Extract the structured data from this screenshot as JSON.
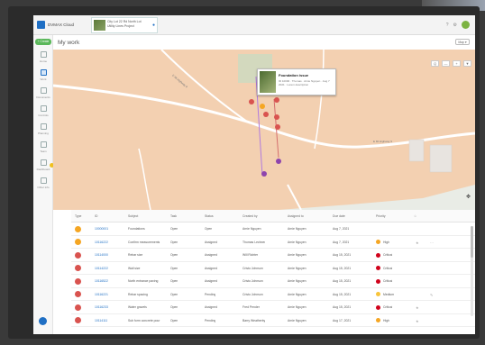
{
  "app": {
    "title": "DVMAX Cloud"
  },
  "project_tab": {
    "title": "City Lot 22 Rd North Lot Utility Lines Project"
  },
  "sidebar": {
    "create_label": "+ Create",
    "items": [
      {
        "label": "Home"
      },
      {
        "label": "Work"
      },
      {
        "label": "Documents"
      },
      {
        "label": "Controls"
      },
      {
        "label": "Planning"
      },
      {
        "label": "Team"
      },
      {
        "label": "Dashboard"
      },
      {
        "label": "Other info"
      }
    ]
  },
  "page": {
    "title": "My work",
    "view_label": "Map ▾"
  },
  "map": {
    "popup_title": "Foundation issue",
    "popup_sub": "ID 10000 · Thomas · Arnie Nguyen · Aug 7 2021 · Lorem description",
    "road_1": "E Mt Highway 9",
    "road_2": "E Mt Highway 9",
    "tools": [
      "Q",
      "—",
      "+",
      "▼"
    ],
    "compass": "✥"
  },
  "table": {
    "columns": [
      "Type",
      "ID",
      "Subject",
      "Task",
      "Status",
      "Created by",
      "Assigned to",
      "Due date",
      "Priority"
    ],
    "rows": [
      {
        "type_color": "#f5a623",
        "id": "10000001",
        "subject": "Foundations",
        "task": "Open",
        "status": "Open",
        "created_by": "Arnie Nguyen",
        "assigned_to": "Arnie Nguyen",
        "due": "Aug 7, 2021",
        "priority": "",
        "priority_color": ""
      },
      {
        "type_color": "#f5a623",
        "id": "10116222",
        "subject": "Confirm measurements",
        "task": "Open",
        "status": "Assigned",
        "created_by": "Thomas Lechner",
        "assigned_to": "Arnie Nguyen",
        "due": "Aug 7, 2021",
        "priority": "High",
        "priority_color": "#f5a623"
      },
      {
        "type_color": "#d9534f",
        "id": "10114000",
        "subject": "Rebar size",
        "task": "Open",
        "status": "Assigned",
        "created_by": "Will Richter",
        "assigned_to": "Arnie Nguyen",
        "due": "Aug 15, 2021",
        "priority": "Critical",
        "priority_color": "#d0021b"
      },
      {
        "type_color": "#d9534f",
        "id": "10114222",
        "subject": "Wall size",
        "task": "Open",
        "status": "Assigned",
        "created_by": "Cristo Johnson",
        "assigned_to": "Arnie Nguyen",
        "due": "Aug 15, 2021",
        "priority": "Critical",
        "priority_color": "#d0021b"
      },
      {
        "type_color": "#d9534f",
        "id": "10116522",
        "subject": "North entrance paving",
        "task": "Open",
        "status": "Assigned",
        "created_by": "Cristo Johnson",
        "assigned_to": "Arnie Nguyen",
        "due": "Aug 15, 2021",
        "priority": "Critical",
        "priority_color": "#d0021b"
      },
      {
        "type_color": "#d9534f",
        "id": "10116221",
        "subject": "Rebar spacing",
        "task": "Open",
        "status": "Pending",
        "created_by": "Cristo Johnson",
        "assigned_to": "Arnie Nguyen",
        "due": "Aug 15, 2021",
        "priority": "Medium",
        "priority_color": "#f8c43a"
      },
      {
        "type_color": "#d9534f",
        "id": "10116233",
        "subject": "Water gravels",
        "task": "Open",
        "status": "Assigned",
        "created_by": "Fred Pender",
        "assigned_to": "Arnie Nguyen",
        "due": "Aug 15, 2021",
        "priority": "Critical",
        "priority_color": "#d0021b"
      },
      {
        "type_color": "#d9534f",
        "id": "10114111",
        "subject": "Sub form concrete pour",
        "task": "Open",
        "status": "Pending",
        "created_by": "Barry Weatherby",
        "assigned_to": "Arnie Nguyen",
        "due": "Aug 17, 2021",
        "priority": "High",
        "priority_color": "#f5a623"
      }
    ]
  }
}
